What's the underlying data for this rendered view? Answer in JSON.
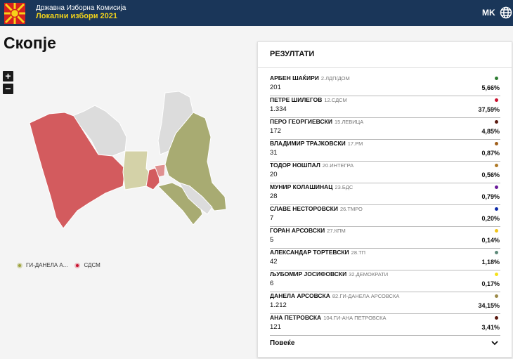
{
  "header": {
    "org": "Државна Изборна Комисија",
    "subtitle": "Локални избори 2021",
    "lang": "MK"
  },
  "page": {
    "city": "Скопје"
  },
  "zoom": {
    "plus": "+",
    "minus": "−"
  },
  "legend": [
    {
      "label": "ГИ-ДАНЕЛА А...",
      "color": "#9da33b"
    },
    {
      "label": "СДСМ",
      "color": "#c8102e"
    }
  ],
  "colors": {
    "header_bg": "#1a3659",
    "map_sdsm": "#d35b5e",
    "map_danela": "#a8ab72",
    "map_levica": "#d4d2a8",
    "map_neutral": "#dcdcdc"
  },
  "results": {
    "title": "РЕЗУЛТАТИ",
    "more_label": "Повеќе",
    "candidates": [
      {
        "name": "АРБЕН ШАЌИРИ",
        "party": "2.ЛДП/ДОМ",
        "votes": "201",
        "pct": "5,66%",
        "color": "#2e7d32"
      },
      {
        "name": "ПЕТРЕ ШИЛЕГОВ",
        "party": "12.СДСМ",
        "votes": "1.334",
        "pct": "37,59%",
        "color": "#c8102e"
      },
      {
        "name": "ПЕРО ГЕОРГИЕВСКИ",
        "party": "15.ЛЕВИЦА",
        "votes": "172",
        "pct": "4,85%",
        "color": "#5a1a10"
      },
      {
        "name": "ВЛАДИМИР ТРАЈКОВСКИ",
        "party": "17.РМ",
        "votes": "31",
        "pct": "0,87%",
        "color": "#a0601c"
      },
      {
        "name": "ТОДОР НОШПАЛ",
        "party": "20.ИНТЕГРА",
        "votes": "20",
        "pct": "0,56%",
        "color": "#b07a28"
      },
      {
        "name": "МУНИР КОЛАШИНАЦ",
        "party": "23.БДС",
        "votes": "28",
        "pct": "0,79%",
        "color": "#6a1b9a"
      },
      {
        "name": "СЛАВЕ НЕСТОРОВСКИ",
        "party": "26.ТМРО",
        "votes": "7",
        "pct": "0,20%",
        "color": "#0d2aa8"
      },
      {
        "name": "ГОРАН АРСОВСКИ",
        "party": "27.КПМ",
        "votes": "5",
        "pct": "0,14%",
        "color": "#f2c51b"
      },
      {
        "name": "АЛЕКСАНДАР ТОРТЕВСКИ",
        "party": "28.ТП",
        "votes": "42",
        "pct": "1,18%",
        "color": "#5e8a7a"
      },
      {
        "name": "ЉУБОМИР ЈОСИФОВСКИ",
        "party": "32.ДЕМОКРАТИ",
        "votes": "6",
        "pct": "0,17%",
        "color": "#f5e11a"
      },
      {
        "name": "ДАНЕЛА АРСОВСКА",
        "party": "82.ГИ-ДАНЕЛА АРСОВСКА",
        "votes": "1.212",
        "pct": "34,15%",
        "color": "#9c8a4a"
      },
      {
        "name": "АНА ПЕТРОВСКА",
        "party": "104.ГИ-АНА ПЕТРОВСКА",
        "votes": "121",
        "pct": "3,41%",
        "color": "#5a1a10"
      }
    ]
  }
}
